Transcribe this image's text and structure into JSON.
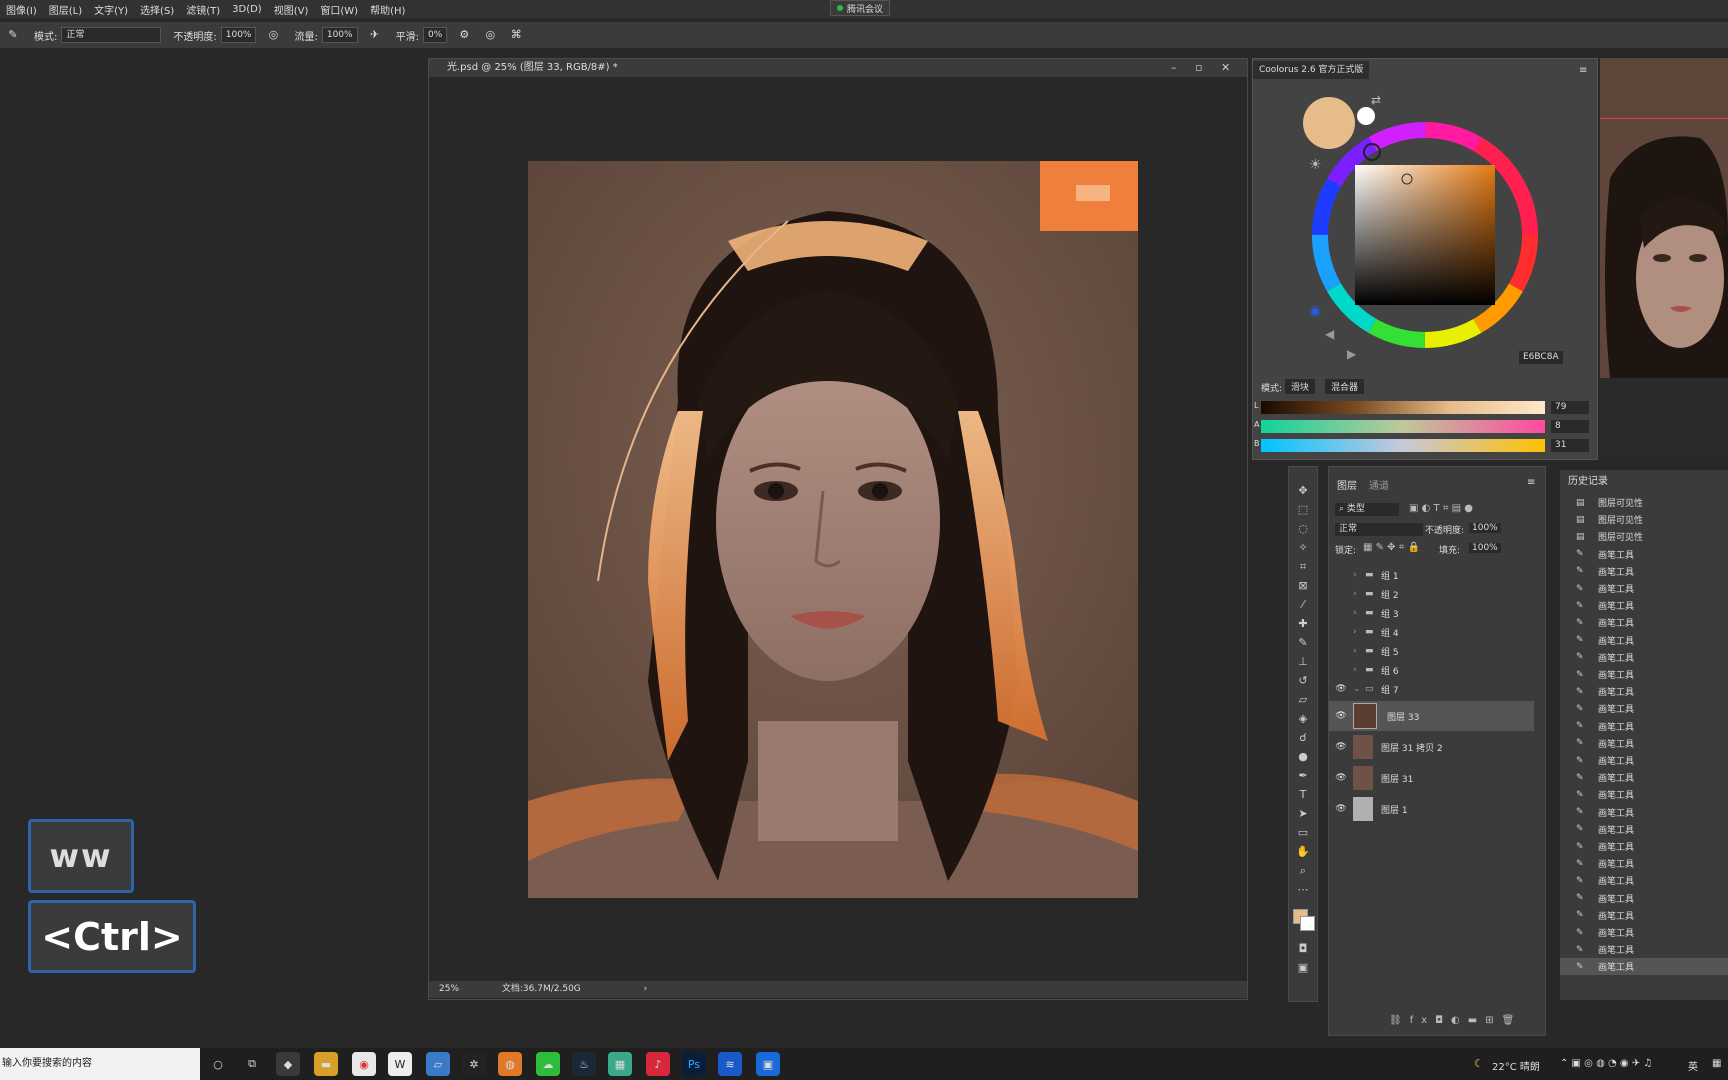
{
  "menu": [
    "图像(I)",
    "图层(L)",
    "文字(Y)",
    "选择(S)",
    "滤镜(T)",
    "3D(D)",
    "视图(V)",
    "窗口(W)",
    "帮助(H)"
  ],
  "meeting_label": "腾讯会议",
  "options": {
    "mode_label": "模式:",
    "mode_value": "正常",
    "opacity_label": "不透明度:",
    "opacity_value": "100%",
    "flow_label": "流量:",
    "flow_value": "100%",
    "smooth_label": "平滑:",
    "smooth_value": "0%"
  },
  "document": {
    "title": "光.psd @ 25% (图层 33, RGB/8#) *",
    "zoom": "25%",
    "doc_size": "文档:36.7M/2.50G"
  },
  "overlay_keys": {
    "key1": "ww",
    "key2": "<Ctrl>"
  },
  "coolorus": {
    "title": "Coolorus 2.6 官方正式版",
    "hex": "E6BC8A",
    "swatch_color": "#E6BC8A",
    "mode_label": "模式:",
    "tab_slider": "滑块",
    "tab_mixer": "混合器",
    "sliders": [
      {
        "label": "L",
        "value": "79"
      },
      {
        "label": "A",
        "value": "8"
      },
      {
        "label": "B",
        "value": "31"
      }
    ]
  },
  "layers": {
    "tab_layers": "图层",
    "tab_channels": "通道",
    "filter": "类型",
    "blend": "正常",
    "opacity_label": "不透明度:",
    "opacity_value": "100%",
    "lock_label": "锁定:",
    "fill_label": "填充:",
    "fill_value": "100%",
    "items": [
      {
        "name": "组 1",
        "kind": "group"
      },
      {
        "name": "组 2",
        "kind": "group"
      },
      {
        "name": "组 3",
        "kind": "group"
      },
      {
        "name": "组 4",
        "kind": "group"
      },
      {
        "name": "组 5",
        "kind": "group"
      },
      {
        "name": "组 6",
        "kind": "group"
      },
      {
        "name": "组 7",
        "kind": "group-open"
      },
      {
        "name": "图层 33",
        "kind": "layer"
      },
      {
        "name": "图层 31 拷贝 2",
        "kind": "layer"
      },
      {
        "name": "图层 31",
        "kind": "layer"
      },
      {
        "name": "图层 1",
        "kind": "layer"
      }
    ]
  },
  "history": {
    "title": "历史记录",
    "items": [
      "图层可见性",
      "图层可见性",
      "图层可见性",
      "画笔工具",
      "画笔工具",
      "画笔工具",
      "画笔工具",
      "画笔工具",
      "画笔工具",
      "画笔工具",
      "画笔工具",
      "画笔工具",
      "画笔工具",
      "画笔工具",
      "画笔工具",
      "画笔工具",
      "画笔工具",
      "画笔工具",
      "画笔工具",
      "画笔工具",
      "画笔工具",
      "画笔工具",
      "画笔工具",
      "画笔工具",
      "画笔工具",
      "画笔工具",
      "画笔工具",
      "画笔工具"
    ]
  },
  "taskbar": {
    "search_placeholder": "输入你要搜索的内容",
    "weather": "22°C 晴朗",
    "lang": "英"
  }
}
